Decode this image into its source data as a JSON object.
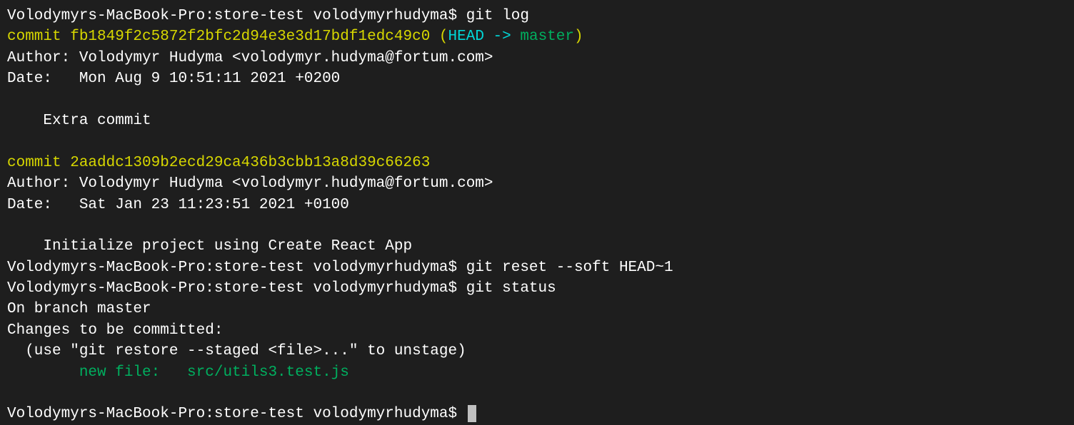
{
  "prompt": "Volodymyrs-MacBook-Pro:store-test volodymyrhudyma$ ",
  "commands": {
    "git_log": "git log",
    "git_reset": "git reset --soft HEAD~1",
    "git_status": "git status"
  },
  "commits": [
    {
      "prefix": "commit ",
      "hash": "fb1849f2c5872f2bfc2d94e3e3d17bdf1edc49c0",
      "ref_open": " (",
      "ref_head": "HEAD -> ",
      "ref_branch": "master",
      "ref_close": ")",
      "author": "Author: Volodymyr Hudyma <volodymyr.hudyma@fortum.com>",
      "date": "Date:   Mon Aug 9 10:51:11 2021 +0200",
      "message": "    Extra commit"
    },
    {
      "prefix": "commit ",
      "hash": "2aaddc1309b2ecd29ca436b3cbb13a8d39c66263",
      "author": "Author: Volodymyr Hudyma <volodymyr.hudyma@fortum.com>",
      "date": "Date:   Sat Jan 23 11:23:51 2021 +0100",
      "message": "    Initialize project using Create React App"
    }
  ],
  "status": {
    "branch": "On branch master",
    "changes_header": "Changes to be committed:",
    "hint": "  (use \"git restore --staged <file>...\" to unstage)",
    "new_file": "        new file:   src/utils3.test.js"
  }
}
